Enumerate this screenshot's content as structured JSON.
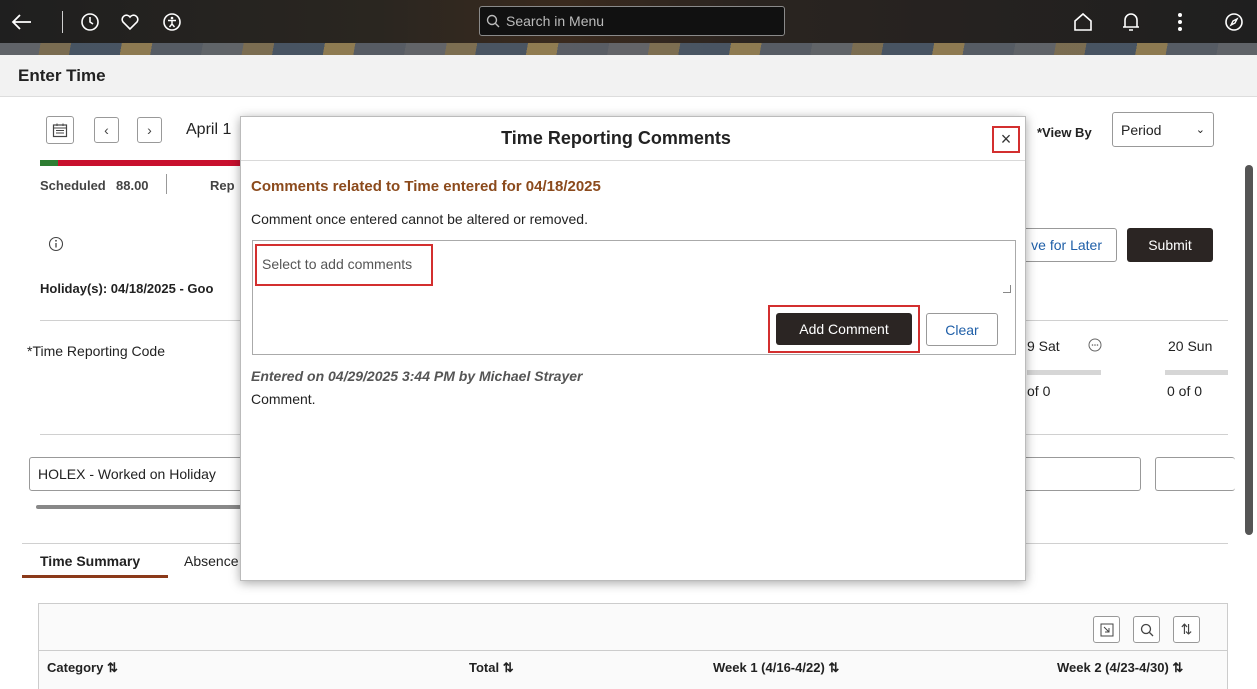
{
  "topbar": {
    "search_placeholder": "Search in Menu"
  },
  "page": {
    "title": "Enter Time"
  },
  "background": {
    "period_label": "April 1",
    "scheduled_label": "Scheduled",
    "scheduled_value": "88.00",
    "reported_fragment": "Rep",
    "holiday_text": "Holiday(s): 04/18/2025 - Goo",
    "view_by_label": "*View By",
    "view_by_value": "Period",
    "save_for_later_label": "ve for Later",
    "submit_label": "Submit",
    "trc_label": "*Time Reporting Code",
    "day_sat": "9 Sat",
    "day_sun": "20 Sun",
    "sat_count": "of 0",
    "sun_count": "0 of 0",
    "trc_value": "HOLEX - Worked on Holiday",
    "tab_time_summary": "Time Summary",
    "tab_absence": "Absence",
    "col_category": "Category ⇅",
    "col_total": "Total ⇅",
    "col_week1": "Week 1 (4/16-4/22) ⇅",
    "col_week2": "Week 2 (4/23-4/30) ⇅"
  },
  "modal": {
    "title": "Time Reporting Comments",
    "subtitle": "Comments related to Time entered for 04/18/2025",
    "note": "Comment once entered cannot be altered or removed.",
    "input_placeholder": "Select to add comments",
    "add_comment_label": "Add Comment",
    "clear_label": "Clear",
    "entered_by": "Entered on 04/29/2025 3:44 PM by Michael Strayer",
    "comment": "Comment."
  },
  "colors": {
    "accent_red": "#d32f2f",
    "heading_brown": "#8b4a1c",
    "dark_button": "#2b2523",
    "link_blue": "#1f5fa8"
  }
}
